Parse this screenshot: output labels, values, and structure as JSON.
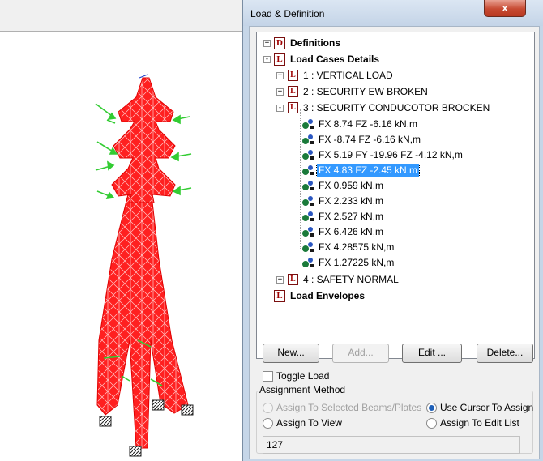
{
  "dialog": {
    "title": "Load & Definition",
    "close_label": "x"
  },
  "tree": {
    "definitions": {
      "badge": "D",
      "label": "Definitions"
    },
    "load_cases": {
      "badge": "L",
      "label": "Load Cases Details"
    },
    "cases": [
      {
        "badge": "L",
        "label": "1 : VERTICAL LOAD"
      },
      {
        "badge": "L",
        "label": "2 : SECURITY EW BROKEN"
      },
      {
        "badge": "L",
        "label": "3 : SECURITY CONDUCOTOR BROCKEN"
      },
      {
        "badge": "L",
        "label": "4 : SAFETY NORMAL"
      }
    ],
    "loads": [
      "FX 8.74 FZ -6.16 kN,m",
      "FX -8.74 FZ -6.16 kN,m",
      "FX 5.19 FY -19.96 FZ -4.12 kN,m",
      "FX 4.83 FZ -2.45 kN,m",
      "FX 0.959 kN,m",
      "FX 2.233 kN,m",
      "FX 2.527 kN,m",
      "FX 6.426 kN,m",
      "FX 4.28575 kN,m",
      "FX 1.27225 kN,m"
    ],
    "selected_load_index": 3,
    "envelopes": {
      "badge": "L",
      "label": "Load Envelopes"
    }
  },
  "buttons": {
    "new": "New...",
    "add": "Add...",
    "edit": "Edit ...",
    "delete": "Delete..."
  },
  "toggle_load": "Toggle Load",
  "assignment": {
    "group_label": "Assignment Method",
    "assign_selected": "Assign To Selected Beams/Plates",
    "use_cursor": "Use Cursor To Assign",
    "assign_view": "Assign To View",
    "assign_edit_list": "Assign To Edit List",
    "value": "127"
  },
  "colors": {
    "tower": "#ff2020",
    "load_arrow": "#33cc33",
    "selection": "#3399ff"
  }
}
